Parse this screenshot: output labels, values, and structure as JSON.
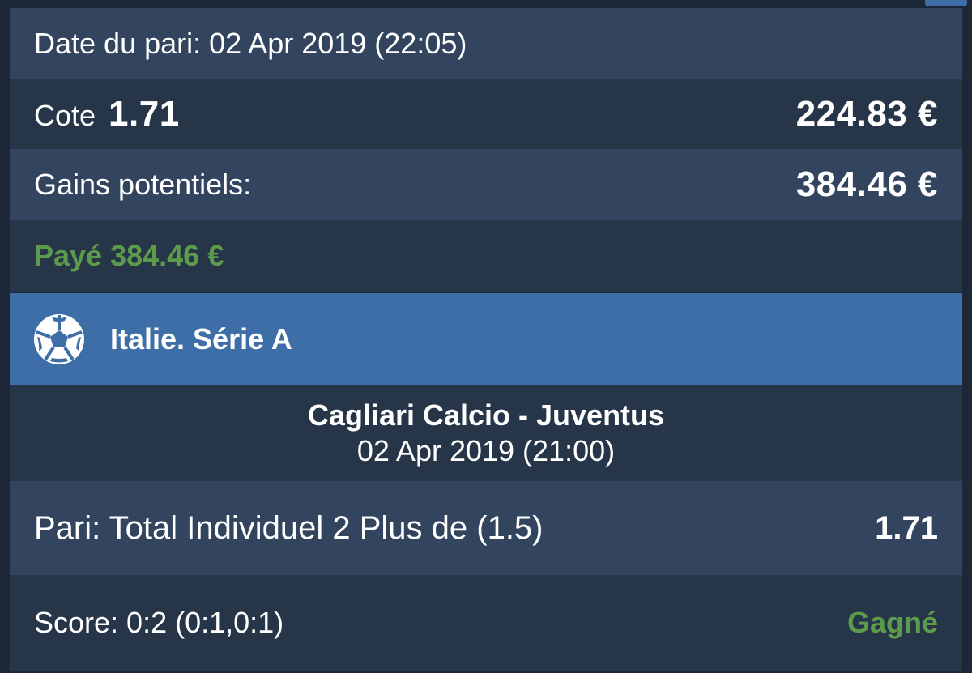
{
  "bet": {
    "date_label": "Date du pari: 02 Apr 2019 (22:05)",
    "cote_label": "Cote",
    "cote_value": "1.71",
    "stake": "224.83 €",
    "gains_label": "Gains potentiels:",
    "gains_value": "384.46 €",
    "paid_text": "Payé 384.46 €"
  },
  "league": {
    "icon": "soccer-ball-icon",
    "name": "Italie. Série A"
  },
  "match": {
    "teams": "Cagliari Calcio - Juventus",
    "date": "02 Apr 2019 (21:00)"
  },
  "selection": {
    "pari_label": "Pari: Total Individuel 2 Plus de (1.5)",
    "odds": "1.71"
  },
  "result": {
    "score": "Score: 0:2 (0:1,0:1)",
    "status": "Gagné"
  },
  "colors": {
    "accent_blue": "#3d6ea8",
    "row_light": "#33455e",
    "row_dark": "#273548",
    "win_green": "#5d9b4c"
  }
}
